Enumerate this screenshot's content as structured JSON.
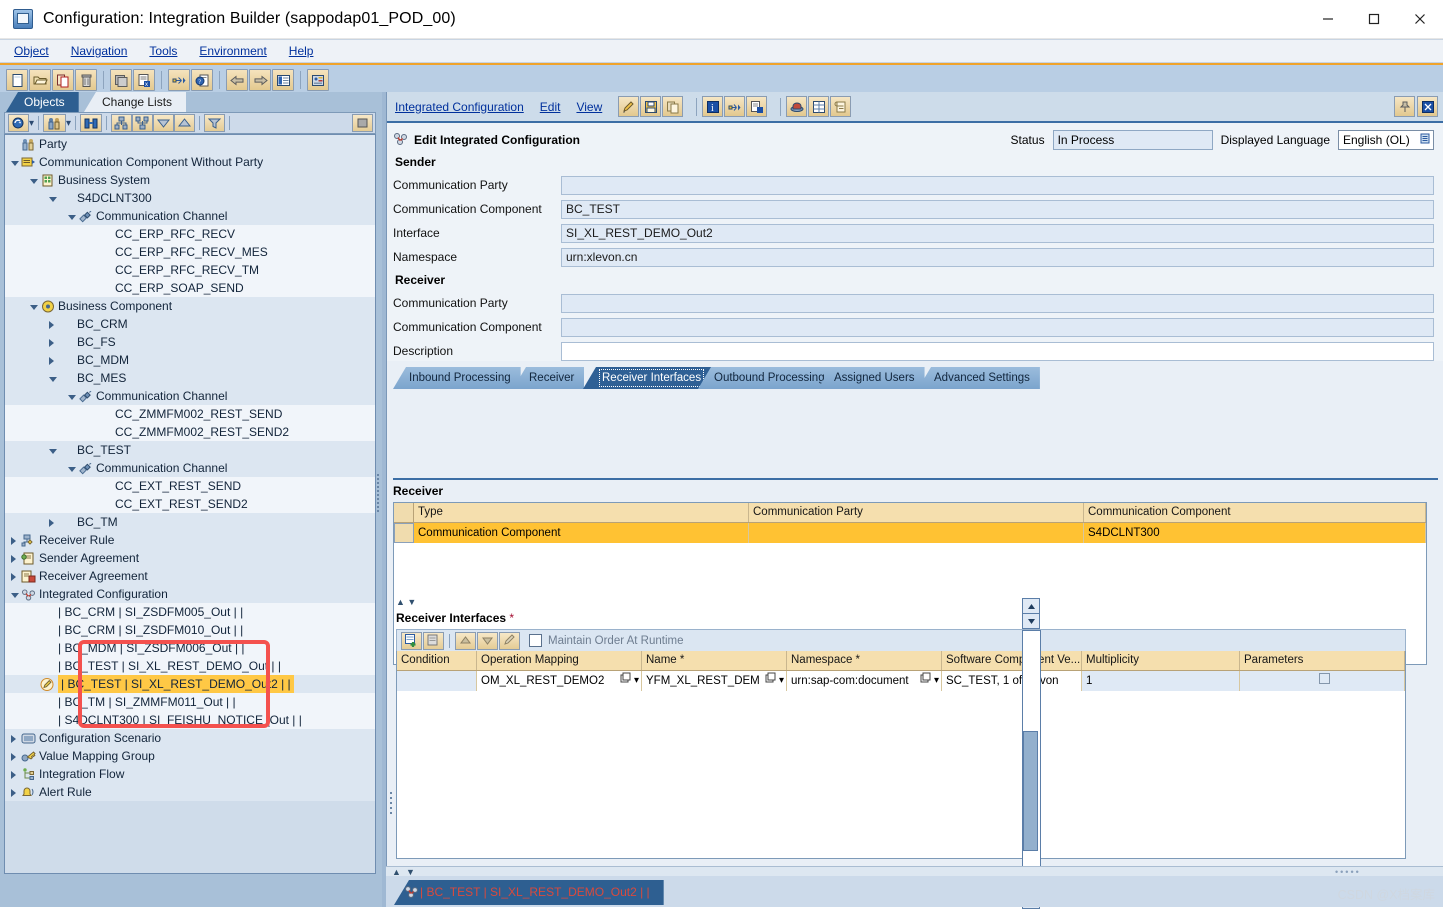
{
  "window": {
    "title": "Configuration: Integration Builder (sappodap01_POD_00)",
    "minimize": "—",
    "maximize": "▢",
    "close": "✕"
  },
  "menubar": {
    "items": [
      "Object",
      "Navigation",
      "Tools",
      "Environment",
      "Help"
    ]
  },
  "main_toolbar": {
    "icons": [
      "new-document-icon",
      "open-folder-icon",
      "copy-icon",
      "delete-trash-icon",
      "save-all-icon",
      "check-object-icon",
      "activate-flow-icon",
      "where-used-icon",
      "back-arrow-icon",
      "forward-arrow-icon",
      "list-view-icon",
      "cache-notification-icon"
    ]
  },
  "left_pane": {
    "tabs": [
      {
        "label": "Objects",
        "selected": true
      },
      {
        "label": "Change Lists",
        "selected": false
      }
    ],
    "toolbar_icons": [
      "refresh-icon",
      "party-find-icon",
      "binoculars-search-icon",
      "expand-node-icon",
      "collapse-node-icon",
      "expand-all-icon",
      "collapse-all-icon",
      "filter-icon",
      "stop-icon"
    ],
    "tree": [
      {
        "depth": 0,
        "twisty": "none",
        "icon": "party-icon",
        "label": "Party"
      },
      {
        "depth": 0,
        "twisty": "down",
        "icon": "comm-component-nopartyicon",
        "label": "Communication Component Without Party"
      },
      {
        "depth": 1,
        "twisty": "down",
        "icon": "business-system-icon",
        "label": "Business System"
      },
      {
        "depth": 2,
        "twisty": "down",
        "icon": "none",
        "label": "S4DCLNT300"
      },
      {
        "depth": 3,
        "twisty": "down",
        "icon": "comm-channel-icon",
        "label": "Communication Channel"
      },
      {
        "depth": 4,
        "twisty": "none",
        "icon": "none",
        "label": "CC_ERP_RFC_RECV"
      },
      {
        "depth": 4,
        "twisty": "none",
        "icon": "none",
        "label": "CC_ERP_RFC_RECV_MES"
      },
      {
        "depth": 4,
        "twisty": "none",
        "icon": "none",
        "label": "CC_ERP_RFC_RECV_TM"
      },
      {
        "depth": 4,
        "twisty": "none",
        "icon": "none",
        "label": "CC_ERP_SOAP_SEND"
      },
      {
        "depth": 1,
        "twisty": "down",
        "icon": "business-component-icon",
        "label": "Business Component"
      },
      {
        "depth": 2,
        "twisty": "right",
        "icon": "none",
        "label": "BC_CRM"
      },
      {
        "depth": 2,
        "twisty": "right",
        "icon": "none",
        "label": "BC_FS"
      },
      {
        "depth": 2,
        "twisty": "right",
        "icon": "none",
        "label": "BC_MDM"
      },
      {
        "depth": 2,
        "twisty": "down",
        "icon": "none",
        "label": "BC_MES"
      },
      {
        "depth": 3,
        "twisty": "down",
        "icon": "comm-channel-icon",
        "label": "Communication Channel"
      },
      {
        "depth": 4,
        "twisty": "none",
        "icon": "none",
        "label": "CC_ZMMFM002_REST_SEND"
      },
      {
        "depth": 4,
        "twisty": "none",
        "icon": "none",
        "label": "CC_ZMMFM002_REST_SEND2"
      },
      {
        "depth": 2,
        "twisty": "down",
        "icon": "none",
        "label": "BC_TEST"
      },
      {
        "depth": 3,
        "twisty": "down",
        "icon": "comm-channel-icon",
        "label": "Communication Channel"
      },
      {
        "depth": 4,
        "twisty": "none",
        "icon": "none",
        "label": "CC_EXT_REST_SEND"
      },
      {
        "depth": 4,
        "twisty": "none",
        "icon": "none",
        "label": "CC_EXT_REST_SEND2"
      },
      {
        "depth": 2,
        "twisty": "right",
        "icon": "none",
        "label": "BC_TM"
      },
      {
        "depth": 0,
        "twisty": "right",
        "icon": "receiver-rule-icon",
        "label": "Receiver Rule"
      },
      {
        "depth": 0,
        "twisty": "right",
        "icon": "sender-agreement-icon",
        "label": "Sender Agreement"
      },
      {
        "depth": 0,
        "twisty": "right",
        "icon": "receiver-agreement-icon",
        "label": "Receiver Agreement"
      },
      {
        "depth": 0,
        "twisty": "down",
        "icon": "integrated-config-icon",
        "label": "Integrated Configuration"
      },
      {
        "depth": 1,
        "twisty": "none",
        "icon": "none",
        "label": "| BC_CRM | SI_ZSDFM005_Out | |"
      },
      {
        "depth": 1,
        "twisty": "none",
        "icon": "none",
        "label": "| BC_CRM | SI_ZSDFM010_Out | |"
      },
      {
        "depth": 1,
        "twisty": "none",
        "icon": "none",
        "label": "| BC_MDM | SI_ZSDFM006_Out | |"
      },
      {
        "depth": 1,
        "twisty": "none",
        "icon": "none",
        "label": "| BC_TEST | SI_XL_REST_DEMO_Out | |"
      },
      {
        "depth": 1,
        "twisty": "none",
        "icon": "edit-pencil-icon",
        "label": "| BC_TEST | SI_XL_REST_DEMO_Out2 | |",
        "highlight": true
      },
      {
        "depth": 1,
        "twisty": "none",
        "icon": "none",
        "label": "| BC_TM | SI_ZMMFM011_Out | |"
      },
      {
        "depth": 1,
        "twisty": "none",
        "icon": "none",
        "label": "| S4DCLNT300 | SI_FEISHU_NOTICE_Out | |"
      },
      {
        "depth": 0,
        "twisty": "right",
        "icon": "config-scenario-icon",
        "label": "Configuration Scenario"
      },
      {
        "depth": 0,
        "twisty": "right",
        "icon": "value-mapping-icon",
        "label": "Value Mapping Group"
      },
      {
        "depth": 0,
        "twisty": "right",
        "icon": "integration-flow-icon",
        "label": "Integration Flow"
      },
      {
        "depth": 0,
        "twisty": "right",
        "icon": "alert-rule-icon",
        "label": "Alert Rule"
      }
    ]
  },
  "right_pane": {
    "toolbar": {
      "menus": [
        "Integrated Configuration",
        "Edit",
        "View"
      ],
      "icons": [
        "edit-pencil-icon",
        "save-icon",
        "copy-icon",
        "info-icon",
        "distribute-icon",
        "check-config-icon",
        "deploy-icon",
        "table-icon",
        "history-icon"
      ],
      "right_icons": [
        "pin-icon",
        "close-x-icon"
      ]
    },
    "header": {
      "title": "Edit Integrated Configuration",
      "status_label": "Status",
      "status_value": "In Process",
      "language_label": "Displayed Language",
      "language_value": "English (OL)"
    },
    "sender": {
      "section": "Sender",
      "fields": [
        {
          "label": "Communication Party",
          "value": ""
        },
        {
          "label": "Communication Component",
          "value": "BC_TEST"
        },
        {
          "label": "Interface",
          "value": "SI_XL_REST_DEMO_Out2"
        },
        {
          "label": "Namespace",
          "value": "urn:xlevon.cn"
        }
      ]
    },
    "receiver": {
      "section": "Receiver",
      "fields": [
        {
          "label": "Communication Party",
          "value": ""
        },
        {
          "label": "Communication Component",
          "value": ""
        },
        {
          "label": "Description",
          "value": "",
          "white": true
        }
      ]
    },
    "tabs": [
      {
        "label": "Inbound Processing",
        "active": false
      },
      {
        "label": "Receiver",
        "active": false
      },
      {
        "label": "Receiver Interfaces",
        "active": true
      },
      {
        "label": "Outbound Processing",
        "active": false
      },
      {
        "label": "Assigned Users",
        "active": false
      },
      {
        "label": "Advanced Settings",
        "active": false
      }
    ],
    "receiver_table": {
      "title": "Receiver",
      "columns": [
        "Type",
        "Communication Party",
        "Communication Component"
      ],
      "rows": [
        {
          "cells": [
            "Communication Component",
            "",
            "S4DCLNT300"
          ],
          "selected": true
        }
      ]
    },
    "receiver_interfaces": {
      "title": "Receiver Interfaces",
      "required_marker": "*",
      "toolbar_icons": [
        "insert-row-icon",
        "delete-row-icon",
        "move-up-icon",
        "move-down-icon",
        "edit-row-icon"
      ],
      "checkbox_label": "Maintain Order At Runtime",
      "checkbox_checked": false,
      "columns": [
        "Condition",
        "Operation Mapping",
        "Name *",
        "Namespace *",
        "Software Component Ve...",
        "Multiplicity",
        "Parameters"
      ],
      "rows": [
        {
          "condition": "",
          "operation_mapping": "OM_XL_REST_DEMO2",
          "name": "YFM_XL_REST_DEM",
          "namespace": "urn:sap-com:document",
          "software_component_version": "SC_TEST, 1 of xlevon",
          "multiplicity": "1",
          "parameters": ""
        }
      ],
      "highlight_box": {
        "target": "operation-mapping-column",
        "color": "#f4514e"
      }
    }
  },
  "bottom_bar": {
    "tab_label": "| BC_TEST | SI_XL_REST_DEMO_Out2 | |",
    "tab_icon": "integrated-config-icon",
    "watermark": "CSDN @X档案库"
  }
}
